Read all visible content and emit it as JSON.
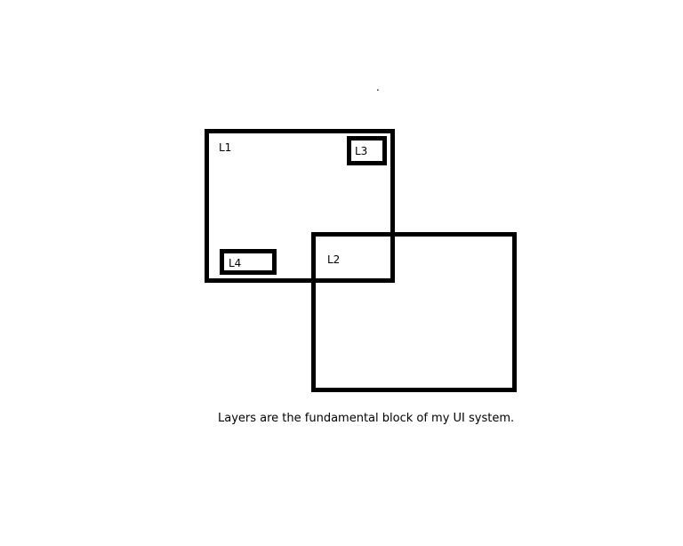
{
  "diagram": {
    "top_mark": ".",
    "layers": [
      {
        "id": "L1",
        "label": "L1"
      },
      {
        "id": "L2",
        "label": "L2"
      },
      {
        "id": "L3",
        "label": "L3"
      },
      {
        "id": "L4",
        "label": "L4"
      }
    ],
    "caption": "Layers are the fundamental block of my UI system."
  }
}
